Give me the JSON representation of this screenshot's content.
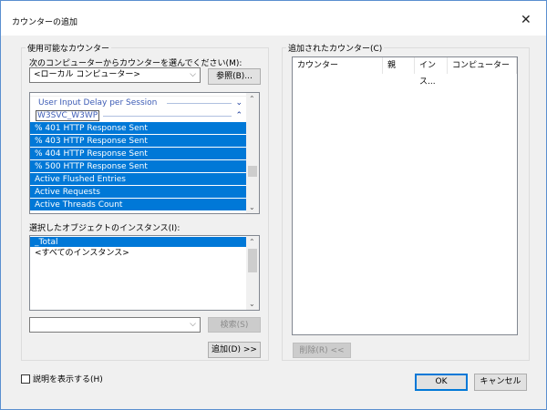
{
  "window": {
    "title": "カウンターの追加",
    "close": "✕"
  },
  "available": {
    "group_label": "使用可能なカウンター",
    "computer_label": "次のコンピューターからカウンターを選んでください(M):",
    "computer_value": "<ローカル コンピューター>",
    "browse_button": "参照(B)...",
    "categories": [
      {
        "name": "User Input Delay per Session",
        "state": "collapsed"
      },
      {
        "name": "W3SVC_W3WP",
        "state": "expanded"
      }
    ],
    "counters": [
      "% 401 HTTP Response Sent",
      "% 403 HTTP Response Sent",
      "% 404 HTTP Response Sent",
      "% 500 HTTP Response Sent",
      "Active Flushed Entries",
      "Active Requests",
      "Active Threads Count"
    ],
    "instances_label": "選択したオブジェクトのインスタンス(I):",
    "instances": [
      "_Total",
      "<すべてのインスタンス>"
    ],
    "search_value": "",
    "search_button": "検索(S)",
    "add_button": "追加(D) >>"
  },
  "added": {
    "group_label": "追加されたカウンター(C)",
    "columns": [
      "カウンター",
      "親",
      "インス...",
      "コンピューター"
    ],
    "remove_button": "削除(R) <<"
  },
  "show_description": {
    "label": "説明を表示する(H)",
    "checked": false
  },
  "ok_button": "OK",
  "cancel_button": "キャンセル",
  "colors": {
    "selection": "#0078d7",
    "category": "#3c5bb5"
  }
}
